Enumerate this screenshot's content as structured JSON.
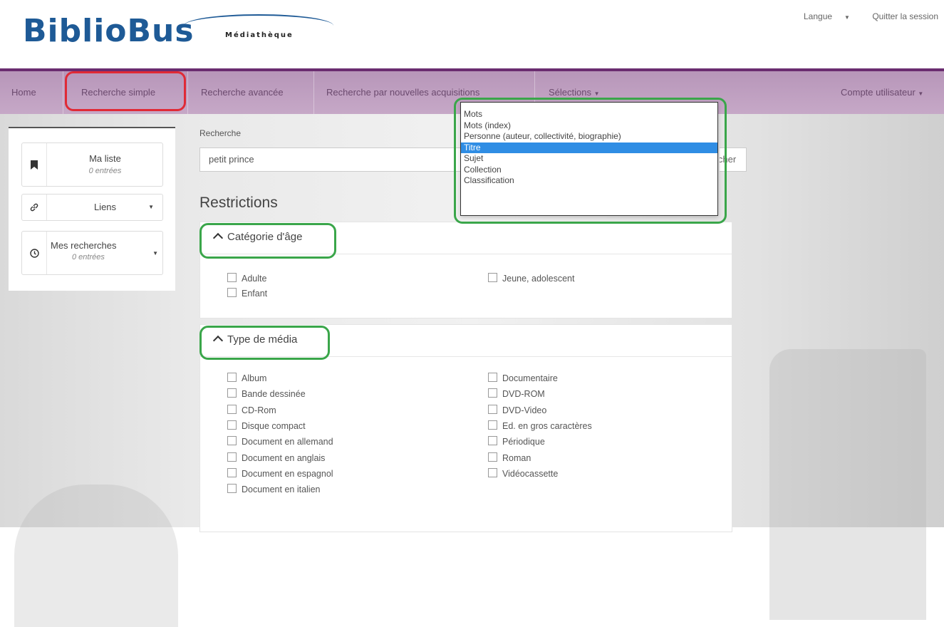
{
  "header": {
    "logo_main": "BiblioBus",
    "logo_sub": "Médiathèque",
    "language_label": "Langue",
    "logout_label": "Quitter la session"
  },
  "nav": {
    "items": [
      {
        "label": "Home"
      },
      {
        "label": "Recherche simple"
      },
      {
        "label": "Recherche avancée"
      },
      {
        "label": "Recherche par nouvelles acquisitions"
      },
      {
        "label": "Sélections"
      }
    ],
    "account_label": "Compte utilisateur"
  },
  "sidebar": {
    "my_list": {
      "title": "Ma liste",
      "count": "0 entrées"
    },
    "links": {
      "title": "Liens"
    },
    "my_searches": {
      "title": "Mes recherches",
      "count": "0 entrées"
    }
  },
  "search": {
    "label": "Recherche",
    "value": "petit prince",
    "button_label": "Rechercher"
  },
  "search_type_dropdown": {
    "options": [
      "Mots",
      "Mots (index)",
      "Personne (auteur, collectivité, biographie)",
      "Titre",
      "Sujet",
      "Collection",
      "Classification"
    ],
    "selected": "Titre"
  },
  "restrictions": {
    "title": "Restrictions",
    "age_category": {
      "title": "Catégorie d'âge",
      "options": [
        "Adulte",
        "Enfant",
        "Jeune, adolescent"
      ]
    },
    "media_type": {
      "title": "Type de média",
      "col1": [
        "Album",
        "Bande dessinée",
        "CD-Rom",
        "Disque compact",
        "Document en allemand",
        "Document en anglais",
        "Document en espagnol",
        "Document en italien"
      ],
      "col2": [
        "Documentaire",
        "DVD-ROM",
        "DVD-Video",
        "Ed. en gros caractères",
        "Périodique",
        "Roman",
        "Vidéocassette"
      ]
    }
  },
  "colors": {
    "nav_bg": "#c3a5c4",
    "nav_border": "#6a2c70",
    "logo_blue": "#1e5a96",
    "highlight_red": "#e02a36",
    "highlight_green": "#3aa64a",
    "dropdown_selected": "#2f8de4"
  }
}
